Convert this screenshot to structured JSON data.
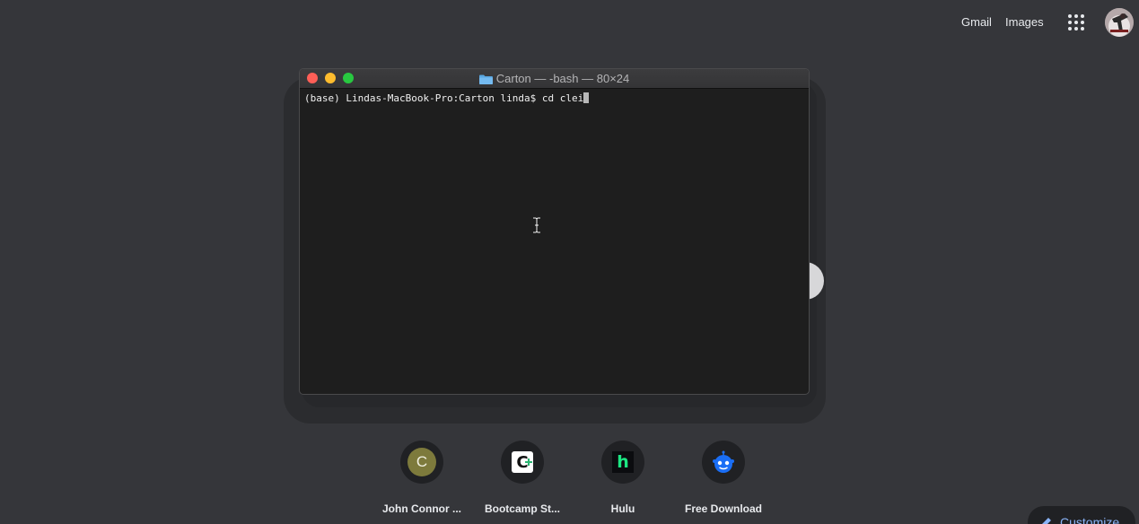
{
  "topbar": {
    "gmail": "Gmail",
    "images": "Images"
  },
  "terminal": {
    "title": "Carton — -bash — 80×24",
    "line": "(base) Lindas-MacBook-Pro:Carton linda$ cd clei"
  },
  "shortcuts": [
    {
      "label": "John Connor ...",
      "icon_letter": "C"
    },
    {
      "label": "Bootcamp St...",
      "icon_letter": "C"
    },
    {
      "label": "Hulu",
      "icon_letter": "h"
    },
    {
      "label": "Free Download"
    }
  ],
  "customize": {
    "label": "Customize"
  },
  "colors": {
    "background": "#35363a",
    "terminal_bg": "#1e1e1e",
    "accent_blue": "#8ab4f8",
    "hulu_green": "#1ce783",
    "reddit_blue": "#1a6ef5"
  }
}
